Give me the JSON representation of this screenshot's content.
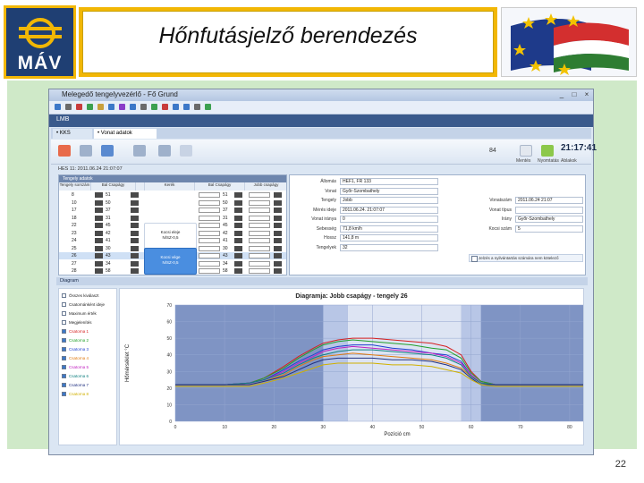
{
  "slide": {
    "title": "Hőnfutásjelző berendezés",
    "logo_text": "MÁV",
    "page_number": "22"
  },
  "window": {
    "title": "Melegedő tengelyvezérlő - Fő Grund",
    "controls": [
      "_",
      "□",
      "×"
    ]
  },
  "app": {
    "tab": "LMB",
    "subtabs": [
      "• KKS",
      "• Vonat adatok"
    ],
    "clock": "21:17:41",
    "clock_prefix": "84",
    "toolbar_labels": [
      "Mentés",
      "Nyomtatás",
      "Ablakok"
    ],
    "record_title": "HES 11: 2011.06.24 21:07:07"
  },
  "grid": {
    "header": "Tengely adatok",
    "columns": [
      "Tengely sorszám",
      "Bal Csapágy",
      "",
      "Kerék",
      "Bal Csapágy",
      "Jobb csapágy"
    ],
    "rows": [
      {
        "axle": "8",
        "left": "51",
        "right": "51"
      },
      {
        "axle": "10",
        "left": "50",
        "right": "50"
      },
      {
        "axle": "17",
        "left": "37",
        "right": "37"
      },
      {
        "axle": "18",
        "left": "31",
        "right": "31"
      },
      {
        "axle": "22",
        "left": "45",
        "right": "45"
      },
      {
        "axle": "23",
        "left": "42",
        "right": "42"
      },
      {
        "axle": "24",
        "left": "41",
        "right": "41"
      },
      {
        "axle": "25",
        "left": "30",
        "right": "30"
      },
      {
        "axle": "26",
        "left": "43",
        "right": "43"
      },
      {
        "axle": "27",
        "left": "34",
        "right": "34"
      },
      {
        "axle": "28",
        "left": "58",
        "right": "58"
      }
    ],
    "card_upper": [
      "Kocsi eleje",
      "N/SZ-0,5"
    ],
    "card_lower": [
      "Kocsi vége",
      "N/SZ-0,5"
    ]
  },
  "form": {
    "fields": [
      {
        "label": "Állomás",
        "value": "HEF1, FR 133"
      },
      {
        "label": "Vonat",
        "value": "Győr-Szombathely"
      },
      {
        "label": "Tengely",
        "value": "Jobb"
      },
      {
        "label": "Mérés ideje",
        "value": "2011.06.24. 21:07:07"
      },
      {
        "label": "Vonat iránya",
        "value": "0"
      },
      {
        "label": "Sebesség",
        "value": "71,8 km/h"
      },
      {
        "label": "Hossz",
        "value": "141,8 m"
      },
      {
        "label": "Tengelyek",
        "value": "32"
      }
    ],
    "right_fields": [
      {
        "label": "Vonatszám",
        "value": "2011.06.24 21:07"
      },
      {
        "label": "Vonat típus",
        "value": ""
      },
      {
        "label": "Irány",
        "value": "Győr-Szombathely"
      },
      {
        "label": "Kocsi szám",
        "value": "5"
      }
    ],
    "checkbox_label": "Jelzés a nyilvántartás számára nem kötelező"
  },
  "diagram": {
    "section_title": "Diagram",
    "legend": [
      {
        "label": "Összes kiválaszt",
        "color": "#222222"
      },
      {
        "label": "Csatornánként ideje",
        "color": "#222222"
      },
      {
        "label": "Maximum érték",
        "color": "#222222"
      },
      {
        "label": "Megjelenítés",
        "color": "#222222"
      },
      {
        "label": "Csatorna 1",
        "color": "#d62020"
      },
      {
        "label": "Csatorna 2",
        "color": "#22a02a"
      },
      {
        "label": "Csatorna 3",
        "color": "#2040d0"
      },
      {
        "label": "Csatorna 4",
        "color": "#e07a10"
      },
      {
        "label": "Csatorna 5",
        "color": "#c020c0"
      },
      {
        "label": "Csatorna 6",
        "color": "#108080"
      },
      {
        "label": "Csatorna 7",
        "color": "#203080"
      },
      {
        "label": "Csatorna 8",
        "color": "#d0b000"
      }
    ]
  },
  "chart_data": {
    "type": "line",
    "title": "Diagramja: Jobb csapágy - tengely 26",
    "xlabel": "Pozíció cm",
    "ylabel": "Hőmérséklet °C",
    "xlim": [
      0,
      90
    ],
    "ylim": [
      0,
      70
    ],
    "xticks": [
      0,
      10,
      20,
      30,
      40,
      50,
      60,
      70,
      80,
      90
    ],
    "yticks": [
      0,
      10,
      20,
      30,
      40,
      50,
      60,
      70
    ],
    "shaded_bands": [
      [
        30,
        35
      ],
      [
        58,
        62
      ]
    ],
    "grid": true,
    "x": [
      0,
      5,
      10,
      15,
      18,
      22,
      25,
      28,
      30,
      33,
      36,
      40,
      44,
      48,
      52,
      55,
      58,
      60,
      62,
      65,
      70,
      75,
      80,
      85,
      90
    ],
    "series": [
      {
        "color": "#d62020",
        "values": [
          22,
          22,
          22,
          23,
          26,
          33,
          39,
          44,
          47,
          49,
          50,
          50,
          49,
          48,
          47,
          45,
          40,
          30,
          24,
          22,
          22,
          22,
          22,
          22,
          22
        ]
      },
      {
        "color": "#22a02a",
        "values": [
          22,
          22,
          22,
          23,
          26,
          32,
          38,
          43,
          46,
          48,
          49,
          48,
          47,
          46,
          44,
          43,
          38,
          29,
          24,
          22,
          22,
          22,
          22,
          22,
          22
        ]
      },
      {
        "color": "#2040d0",
        "values": [
          22,
          22,
          22,
          23,
          25,
          31,
          36,
          40,
          43,
          45,
          46,
          46,
          44,
          43,
          41,
          40,
          36,
          28,
          23,
          22,
          22,
          22,
          22,
          22,
          22
        ]
      },
      {
        "color": "#e07a10",
        "values": [
          22,
          22,
          22,
          22,
          24,
          28,
          33,
          37,
          39,
          40,
          41,
          40,
          39,
          38,
          37,
          35,
          32,
          27,
          23,
          22,
          22,
          22,
          22,
          22,
          22
        ]
      },
      {
        "color": "#c020c0",
        "values": [
          22,
          22,
          22,
          23,
          25,
          30,
          35,
          39,
          42,
          44,
          45,
          44,
          43,
          42,
          41,
          39,
          35,
          28,
          23,
          22,
          22,
          22,
          22,
          22,
          22
        ]
      },
      {
        "color": "#108080",
        "values": [
          22,
          22,
          22,
          23,
          25,
          29,
          34,
          38,
          40,
          42,
          43,
          43,
          42,
          41,
          40,
          38,
          34,
          27,
          23,
          22,
          22,
          22,
          22,
          22,
          22
        ]
      },
      {
        "color": "#203080",
        "values": [
          22,
          22,
          22,
          22,
          24,
          27,
          31,
          35,
          37,
          38,
          38,
          38,
          37,
          37,
          36,
          34,
          31,
          26,
          22,
          22,
          22,
          22,
          22,
          22,
          22
        ]
      },
      {
        "color": "#d0b000",
        "values": [
          21,
          21,
          21,
          21,
          23,
          26,
          29,
          32,
          34,
          35,
          35,
          35,
          34,
          34,
          33,
          31,
          29,
          25,
          22,
          21,
          21,
          21,
          21,
          21,
          21
        ]
      }
    ]
  }
}
